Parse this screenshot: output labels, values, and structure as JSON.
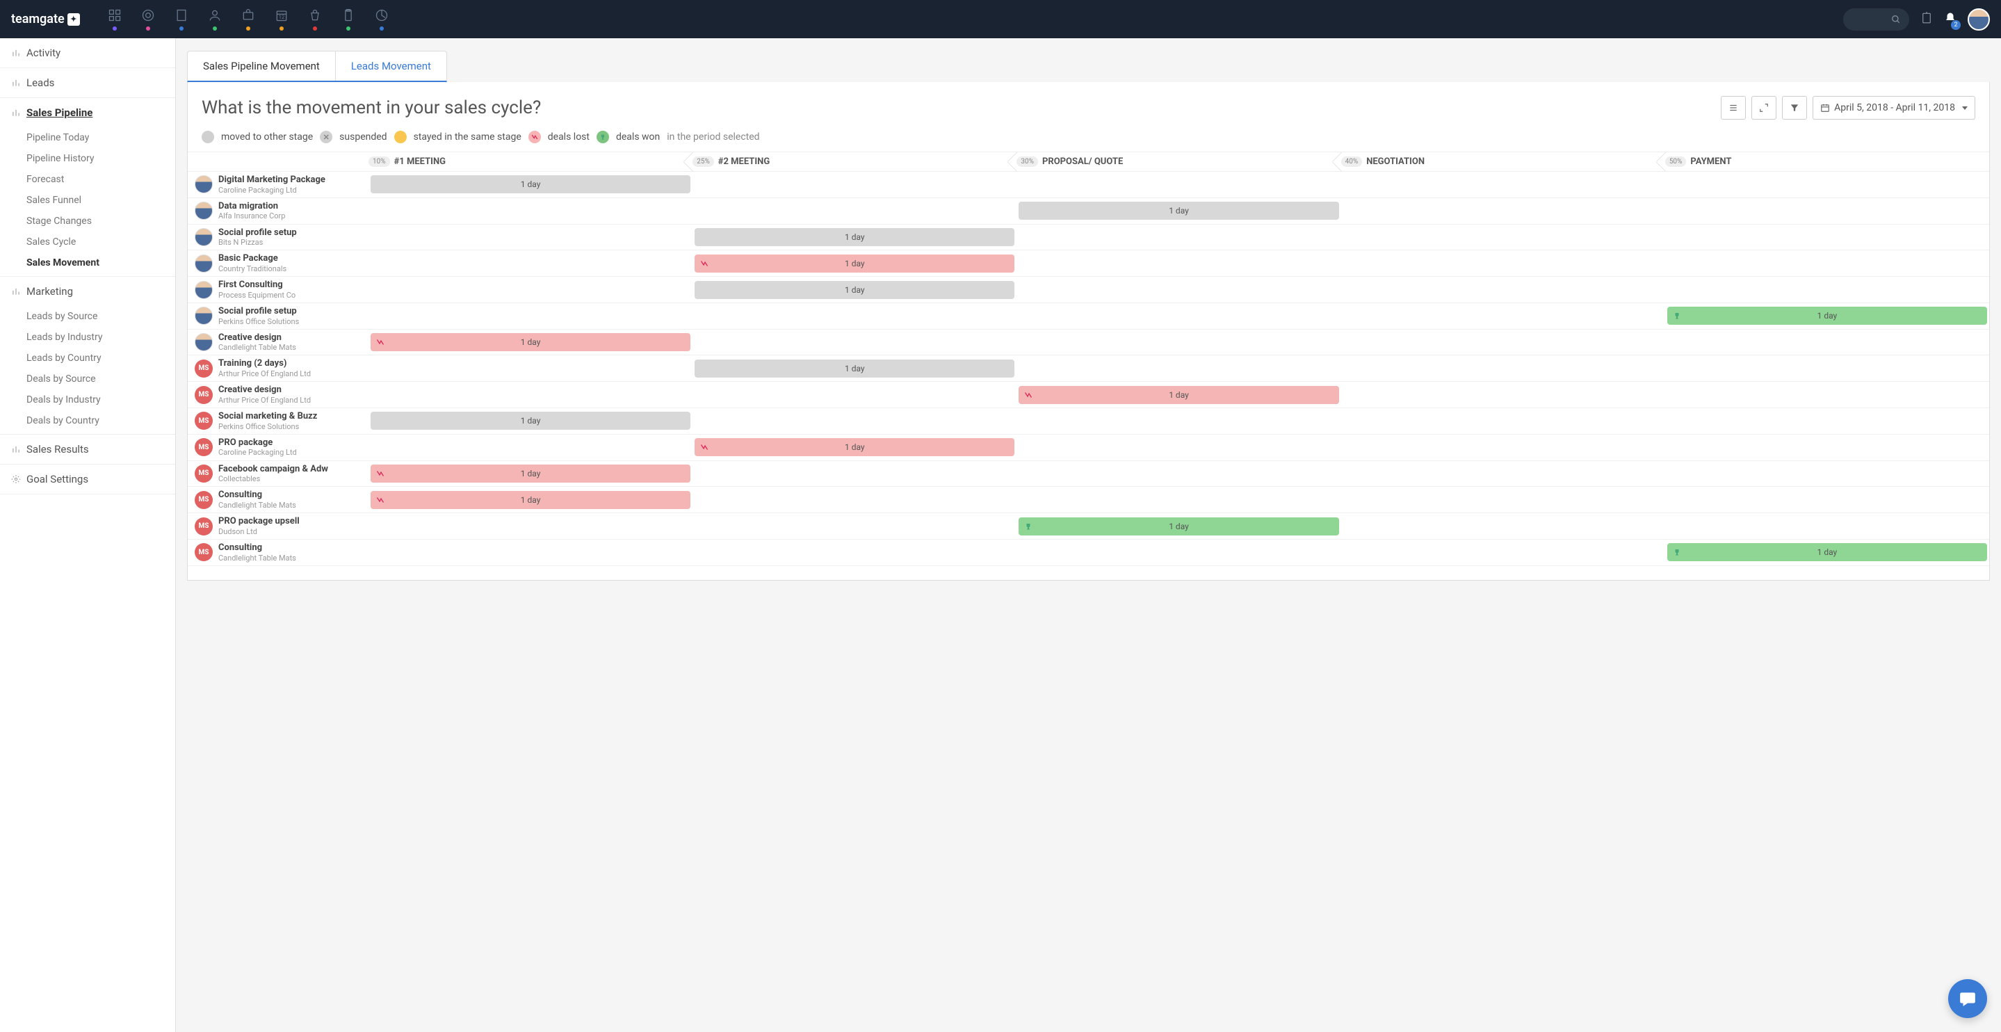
{
  "brand": "teamgate",
  "notificationCount": "2",
  "topDotColors": [
    "#7a5cff",
    "#e04f9e",
    "#3a7bd5",
    "#3ec46d",
    "#f0a020",
    "#f0a020",
    "#e03a3a",
    "#3ec46d",
    "#3a7bd5"
  ],
  "sidebar": [
    {
      "title": "Activity",
      "type": "title",
      "icon": "bar"
    },
    {
      "title": "Leads",
      "type": "title",
      "icon": "bar"
    },
    {
      "title": "Sales Pipeline",
      "type": "title",
      "icon": "bar",
      "active": true,
      "items": [
        {
          "label": "Pipeline Today"
        },
        {
          "label": "Pipeline History"
        },
        {
          "label": "Forecast"
        },
        {
          "label": "Sales Funnel"
        },
        {
          "label": "Stage Changes"
        },
        {
          "label": "Sales Cycle"
        },
        {
          "label": "Sales Movement",
          "active": true
        }
      ]
    },
    {
      "title": "Marketing",
      "type": "title",
      "icon": "bar",
      "items": [
        {
          "label": "Leads by Source"
        },
        {
          "label": "Leads by Industry"
        },
        {
          "label": "Leads by Country"
        },
        {
          "label": "Deals by Source"
        },
        {
          "label": "Deals by Industry"
        },
        {
          "label": "Deals by Country"
        }
      ]
    },
    {
      "title": "Sales Results",
      "type": "title",
      "icon": "bar"
    },
    {
      "title": "Goal Settings",
      "type": "title",
      "icon": "gear"
    }
  ],
  "tabs": [
    {
      "label": "Sales Pipeline Movement",
      "active": true
    },
    {
      "label": "Leads Movement"
    }
  ],
  "pageTitle": "What is the movement in your sales cycle?",
  "dateRange": "April 5, 2018 - April 11, 2018",
  "legend": {
    "moved": "moved to other stage",
    "suspended": "suspended",
    "stayed": "stayed in the same stage",
    "lost": "deals lost",
    "won": "deals won",
    "tail": "in the period selected"
  },
  "stages": [
    {
      "pct": "10%",
      "name": "#1 MEETING"
    },
    {
      "pct": "25%",
      "name": "#2 MEETING"
    },
    {
      "pct": "30%",
      "name": "PROPOSAL/ QUOTE"
    },
    {
      "pct": "40%",
      "name": "NEGOTIATION"
    },
    {
      "pct": "50%",
      "name": "PAYMENT"
    }
  ],
  "rows": [
    {
      "avatar": "photo",
      "deal": "Digital Marketing Package",
      "co": "Caroline Packaging Ltd",
      "stage": 0,
      "kind": "gray",
      "dur": "1 day"
    },
    {
      "avatar": "photo",
      "deal": "Data migration",
      "co": "Alfa Insurance Corp",
      "stage": 2,
      "kind": "gray",
      "dur": "1 day"
    },
    {
      "avatar": "photo",
      "deal": "Social profile setup",
      "co": "Bits N Pizzas",
      "stage": 1,
      "kind": "gray",
      "dur": "1 day"
    },
    {
      "avatar": "photo",
      "deal": "Basic Package",
      "co": "Country Traditionals",
      "stage": 1,
      "kind": "pink",
      "dur": "1 day"
    },
    {
      "avatar": "photo",
      "deal": "First Consulting",
      "co": "Process Equipment Co",
      "stage": 1,
      "kind": "gray",
      "dur": "1 day"
    },
    {
      "avatar": "photo",
      "deal": "Social profile setup",
      "co": "Perkins Office Solutions",
      "stage": 4,
      "kind": "green",
      "dur": "1 day"
    },
    {
      "avatar": "photo",
      "deal": "Creative design",
      "co": "Candlelight Table Mats",
      "stage": 0,
      "kind": "pink",
      "dur": "1 day"
    },
    {
      "avatar": "init",
      "init": "MS",
      "deal": "Training (2 days)",
      "co": "Arthur Price Of England Ltd",
      "stage": 1,
      "kind": "gray",
      "dur": "1 day"
    },
    {
      "avatar": "init",
      "init": "MS",
      "deal": "Creative design",
      "co": "Arthur Price Of England Ltd",
      "stage": 2,
      "kind": "pink",
      "dur": "1 day"
    },
    {
      "avatar": "init",
      "init": "MS",
      "deal": "Social marketing & Buzz",
      "co": "Perkins Office Solutions",
      "stage": 0,
      "kind": "gray",
      "dur": "1 day"
    },
    {
      "avatar": "init",
      "init": "MS",
      "deal": "PRO package",
      "co": "Caroline Packaging Ltd",
      "stage": 1,
      "kind": "pink",
      "dur": "1 day"
    },
    {
      "avatar": "init",
      "init": "MS",
      "deal": "Facebook campaign & Adw",
      "co": "Collectables",
      "stage": 0,
      "kind": "pink",
      "dur": "1 day"
    },
    {
      "avatar": "init",
      "init": "MS",
      "deal": "Consulting",
      "co": "Candlelight Table Mats",
      "stage": 0,
      "kind": "pink",
      "dur": "1 day"
    },
    {
      "avatar": "init",
      "init": "MS",
      "deal": "PRO package upsell",
      "co": "Dudson Ltd",
      "stage": 2,
      "kind": "green",
      "dur": "1 day"
    },
    {
      "avatar": "init",
      "init": "MS",
      "deal": "Consulting",
      "co": "Candlelight Table Mats",
      "stage": 4,
      "kind": "green",
      "dur": "1 day"
    }
  ]
}
